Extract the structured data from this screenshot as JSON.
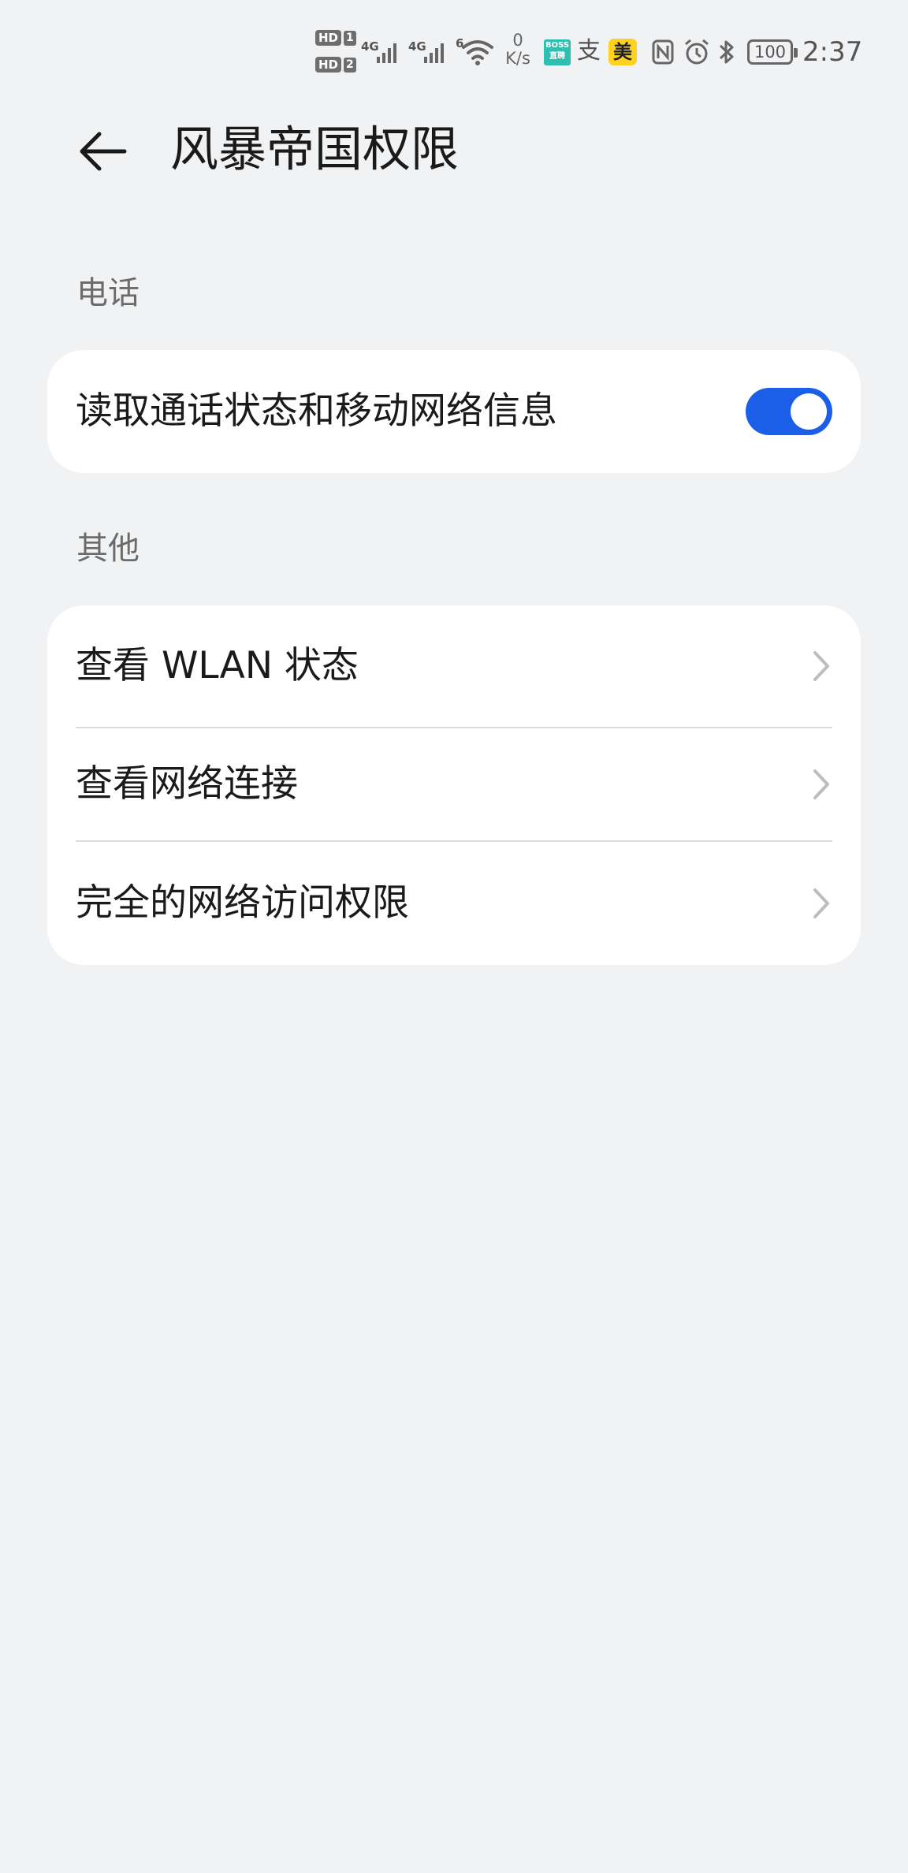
{
  "status_bar": {
    "hd1": "HD",
    "hd1_num": "1",
    "hd2": "HD",
    "hd2_num": "2",
    "sim1_type": "4G",
    "sim2_type": "4G",
    "wifi_type": "6",
    "speed_value": "0",
    "speed_unit": "K/s",
    "boss_line1": "BOSS",
    "boss_line2": "直聘",
    "pay_glyph": "支",
    "mei_label": "美",
    "battery": "100",
    "time": "2:37"
  },
  "header": {
    "title": "风暴帝国权限"
  },
  "sections": {
    "phone": {
      "label": "电话",
      "items": [
        {
          "label": "读取通话状态和移动网络信息",
          "enabled": true
        }
      ]
    },
    "other": {
      "label": "其他",
      "items": [
        {
          "label": "查看 WLAN 状态"
        },
        {
          "label": "查看网络连接"
        },
        {
          "label": "完全的网络访问权限"
        }
      ]
    }
  },
  "colors": {
    "background": "#f1f2f4",
    "card": "#ffffff",
    "accent": "#1b5ee8",
    "text_primary": "#1a1a1a",
    "text_secondary": "#6b6b6b"
  }
}
